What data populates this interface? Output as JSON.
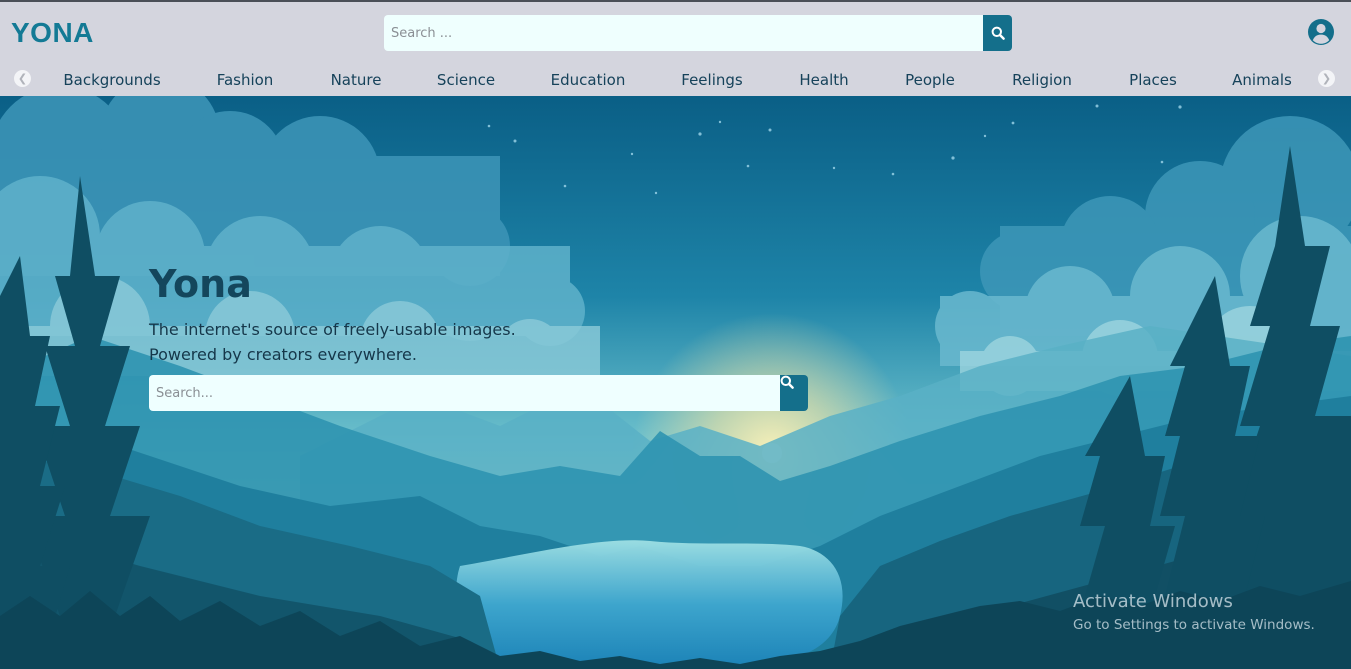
{
  "header": {
    "logo": "YONA",
    "search": {
      "placeholder": "Search ..."
    }
  },
  "nav": {
    "items": [
      "Backgrounds",
      "Fashion",
      "Nature",
      "Science",
      "Education",
      "Feelings",
      "Health",
      "People",
      "Religion",
      "Places",
      "Animals"
    ]
  },
  "hero": {
    "title": "Yona",
    "subtitle_line1": "The internet's source of freely-usable images.",
    "subtitle_line2": "Powered by creators everywhere.",
    "search": {
      "placeholder": "Search..."
    }
  },
  "watermark": {
    "title": "Activate Windows",
    "subtitle": "Go to Settings to activate Windows."
  },
  "icons": {
    "search": "search-icon",
    "user": "user-circle-icon",
    "nav_prev": "chevron-left-icon",
    "nav_next": "chevron-right-icon"
  },
  "colors": {
    "brand": "#137a95",
    "button": "#146f8b",
    "header_bg": "#d4d5de",
    "nav_text": "#16425a"
  }
}
